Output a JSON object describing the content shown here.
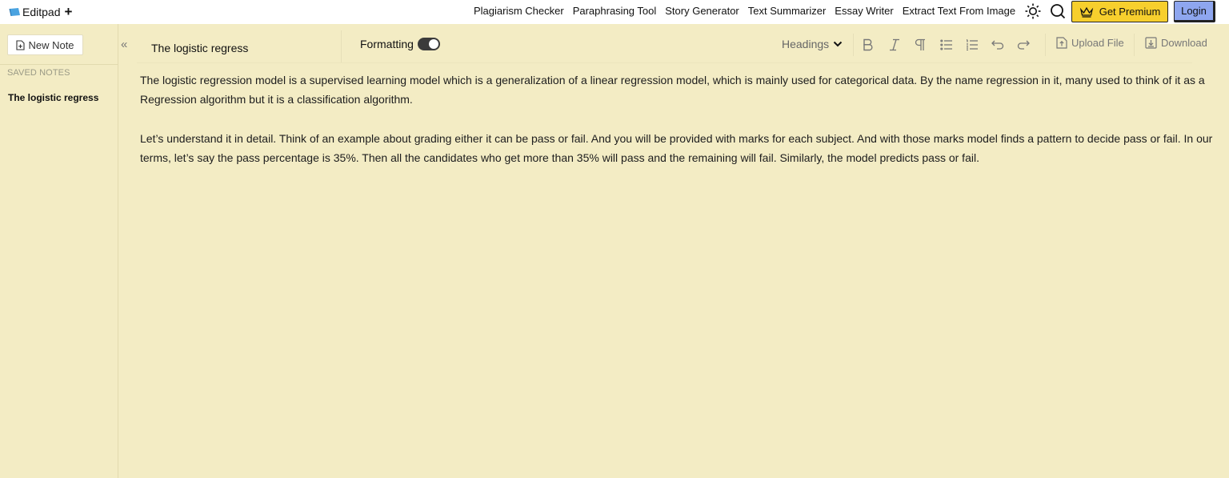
{
  "header": {
    "logo_text": "Editpad",
    "logo_plus": "+",
    "nav": [
      "Plagiarism Checker",
      "Paraphrasing Tool",
      "Story Generator",
      "Text Summarizer",
      "Essay Writer",
      "Extract Text From Image"
    ],
    "premium_label": "Get Premium",
    "login_label": "Login",
    "colors": {
      "premium": "#f7cf2d",
      "login": "#8ea6ef",
      "background": "#f3ecc4"
    }
  },
  "sidebar": {
    "new_note_label": "New Note",
    "saved_notes_label": "SAVED NOTES",
    "saved_items": [
      "The logistic regress"
    ],
    "collapse_icon": "«"
  },
  "toolbar": {
    "note_title": "The logistic regress",
    "formatting_label": "Formatting",
    "formatting_on": true,
    "headings_label": "Headings",
    "upload_label": "Upload File",
    "download_label": "Download"
  },
  "editor": {
    "paragraphs": [
      "The logistic regression model is a supervised learning model which is a generalization of a linear regression model, which is mainly used for categorical data. By the name regression in it, many used to think of it as a Regression algorithm but it is a classification algorithm.",
      "Let’s understand it in detail. Think of an example about grading either it can be pass or fail. And you will be provided with marks for each subject. And with those marks model finds a pattern to decide pass or fail. In our terms, let’s say the pass percentage is 35%. Then all the candidates who get more than 35% will pass and the remaining will fail. Similarly, the model predicts pass or fail."
    ]
  }
}
